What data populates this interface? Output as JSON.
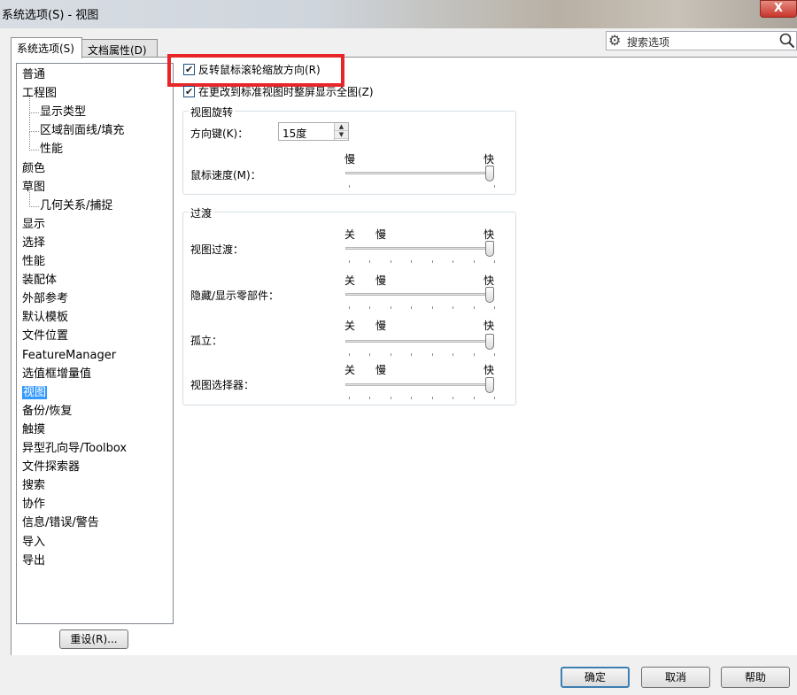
{
  "window": {
    "title": "系统选项(S) - 视图",
    "close_label": "X"
  },
  "tabs": [
    {
      "label": "系统选项(S)",
      "active": true
    },
    {
      "label": "文档属性(D)",
      "active": false
    }
  ],
  "search": {
    "placeholder": "搜索选项",
    "gear_icon": "gear-icon",
    "search_icon": "magnifier-icon"
  },
  "tree": [
    {
      "label": "普通"
    },
    {
      "label": "工程图"
    },
    {
      "label": "显示类型",
      "child": true
    },
    {
      "label": "区域剖面线/填充",
      "child": true
    },
    {
      "label": "性能",
      "child": true
    },
    {
      "label": "颜色"
    },
    {
      "label": "草图"
    },
    {
      "label": "几何关系/捕捉",
      "child": true
    },
    {
      "label": "显示"
    },
    {
      "label": "选择"
    },
    {
      "label": "性能"
    },
    {
      "label": "装配体"
    },
    {
      "label": "外部参考"
    },
    {
      "label": "默认模板"
    },
    {
      "label": "文件位置"
    },
    {
      "label": "FeatureManager"
    },
    {
      "label": "选值框增量值"
    },
    {
      "label": "视图",
      "selected": true
    },
    {
      "label": "备份/恢复"
    },
    {
      "label": "触摸"
    },
    {
      "label": "异型孔向导/Toolbox"
    },
    {
      "label": "文件探索器"
    },
    {
      "label": "搜索"
    },
    {
      "label": "协作"
    },
    {
      "label": "信息/错误/警告"
    },
    {
      "label": "导入"
    },
    {
      "label": "导出"
    }
  ],
  "reset_label": "重设(R)...",
  "options": {
    "reverse_wheel": {
      "label": "反转鼠标滚轮缩放方向(R)",
      "checked": true
    },
    "zoom_to_fit": {
      "label": "在更改到标准视图时整屏显示全图(Z)",
      "checked": true
    }
  },
  "rotation": {
    "title": "视图旋转",
    "arrow_key_label": "方向键(K)：",
    "arrow_key_value": "15度",
    "mouse_speed_label": "鼠标速度(M)：",
    "slow": "慢",
    "fast": "快",
    "mouse_speed_level": 1.0
  },
  "transition": {
    "title": "过渡",
    "off": "关",
    "slow": "慢",
    "fast": "快",
    "items": [
      {
        "label": "视图过渡：",
        "level": 1.0
      },
      {
        "label": "隐藏/显示零部件：",
        "level": 1.0
      },
      {
        "label": "孤立：",
        "level": 1.0
      },
      {
        "label": "视图选择器：",
        "level": 1.0
      }
    ]
  },
  "buttons": {
    "ok": "确定",
    "cancel": "取消",
    "help": "帮助"
  }
}
